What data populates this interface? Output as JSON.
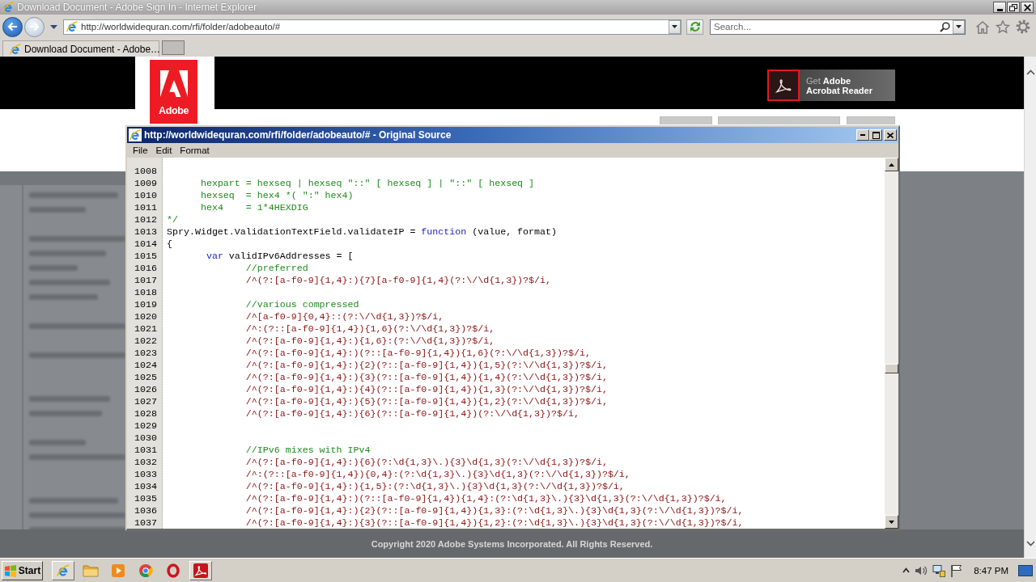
{
  "browser": {
    "title": "Download Document - Adobe Sign In - Internet Explorer",
    "address": "http://worldwidequran.com/rfi/folder/adobeauto/#",
    "search": {
      "placeholder": "Search..."
    },
    "tabs": [
      {
        "label": "Download Document - Adobe…",
        "selected": true
      }
    ]
  },
  "page": {
    "logo": "Adobe",
    "reader_button": {
      "lead": "Get",
      "title": "Adobe",
      "subtitle": "Acrobat Reader"
    },
    "footer": "Copyright 2020 Adobe Systems Incorporated. All Rights Reserved."
  },
  "source_window": {
    "title": "http://worldwidequran.com/rfi/folder/adobeauto/# - Original Source",
    "menu": [
      "File",
      "Edit",
      "Format"
    ],
    "lines": [
      {
        "number": "1008"
      },
      {
        "number": "1009",
        "segments": [
          {
            "kind": "comment",
            "text": "      hexpart = hexseq | hexseq \"::\" [ hexseq ] | \"::\" [ hexseq ]"
          }
        ]
      },
      {
        "number": "1010",
        "segments": [
          {
            "kind": "comment",
            "text": "      hexseq  = hex4 *( \":\" hex4)"
          }
        ]
      },
      {
        "number": "1011",
        "segments": [
          {
            "kind": "comment",
            "text": "      hex4    = 1*4HEXDIG"
          }
        ]
      },
      {
        "number": "1012",
        "segments": [
          {
            "kind": "comment",
            "text": "*/"
          }
        ]
      },
      {
        "number": "1013",
        "segments": [
          {
            "kind": "plain",
            "text": "Spry.Widget.ValidationTextField.validateIP = "
          },
          {
            "kind": "keyword",
            "text": "function"
          },
          {
            "kind": "plain",
            "text": " (value, format)"
          }
        ]
      },
      {
        "number": "1014",
        "segments": [
          {
            "kind": "plain",
            "text": "{"
          }
        ]
      },
      {
        "number": "1015",
        "segments": [
          {
            "kind": "keyword",
            "text": "       var"
          },
          {
            "kind": "plain",
            "text": " validIPv6Addresses = ["
          }
        ]
      },
      {
        "number": "1016",
        "segments": [
          {
            "kind": "comment",
            "text": "              //preferred"
          }
        ]
      },
      {
        "number": "1017",
        "segments": [
          {
            "kind": "regex",
            "text": "              /^(?:[a-f0-9]{1,4}:){7}[a-f0-9]{1,4}(?:\\/\\d{1,3})?$/i,"
          }
        ]
      },
      {
        "number": "1018"
      },
      {
        "number": "1019",
        "segments": [
          {
            "kind": "comment",
            "text": "              //various compressed"
          }
        ]
      },
      {
        "number": "1020",
        "segments": [
          {
            "kind": "regex",
            "text": "              /^[a-f0-9]{0,4}::(?:\\/\\d{1,3})?$/i,"
          }
        ]
      },
      {
        "number": "1021",
        "segments": [
          {
            "kind": "regex",
            "text": "              /^:(?::[a-f0-9]{1,4}){1,6}(?:\\/\\d{1,3})?$/i,"
          }
        ]
      },
      {
        "number": "1022",
        "segments": [
          {
            "kind": "regex",
            "text": "              /^(?:[a-f0-9]{1,4}:){1,6}:(?:\\/\\d{1,3})?$/i,"
          }
        ]
      },
      {
        "number": "1023",
        "segments": [
          {
            "kind": "regex",
            "text": "              /^(?:[a-f0-9]{1,4}:)(?::[a-f0-9]{1,4}){1,6}(?:\\/\\d{1,3})?$/i,"
          }
        ]
      },
      {
        "number": "1024",
        "segments": [
          {
            "kind": "regex",
            "text": "              /^(?:[a-f0-9]{1,4}:){2}(?::[a-f0-9]{1,4}){1,5}(?:\\/\\d{1,3})?$/i,"
          }
        ]
      },
      {
        "number": "1025",
        "segments": [
          {
            "kind": "regex",
            "text": "              /^(?:[a-f0-9]{1,4}:){3}(?::[a-f0-9]{1,4}){1,4}(?:\\/\\d{1,3})?$/i,"
          }
        ]
      },
      {
        "number": "1026",
        "segments": [
          {
            "kind": "regex",
            "text": "              /^(?:[a-f0-9]{1,4}:){4}(?::[a-f0-9]{1,4}){1,3}(?:\\/\\d{1,3})?$/i,"
          }
        ]
      },
      {
        "number": "1027",
        "segments": [
          {
            "kind": "regex",
            "text": "              /^(?:[a-f0-9]{1,4}:){5}(?::[a-f0-9]{1,4}){1,2}(?:\\/\\d{1,3})?$/i,"
          }
        ]
      },
      {
        "number": "1028",
        "segments": [
          {
            "kind": "regex",
            "text": "              /^(?:[a-f0-9]{1,4}:){6}(?::[a-f0-9]{1,4})(?:\\/\\d{1,3})?$/i,"
          }
        ]
      },
      {
        "number": "1029"
      },
      {
        "number": "1030"
      },
      {
        "number": "1031",
        "segments": [
          {
            "kind": "comment",
            "text": "              //IPv6 mixes with IPv4"
          }
        ]
      },
      {
        "number": "1032",
        "segments": [
          {
            "kind": "regex",
            "text": "              /^(?:[a-f0-9]{1,4}:){6}(?:\\d{1,3}\\.){3}\\d{1,3}(?:\\/\\d{1,3})?$/i,"
          }
        ]
      },
      {
        "number": "1033",
        "segments": [
          {
            "kind": "regex",
            "text": "              /^:(?::[a-f0-9]{1,4}){0,4}:(?:\\d{1,3}\\.){3}\\d{1,3}(?:\\/\\d{1,3})?$/i,"
          }
        ]
      },
      {
        "number": "1034",
        "segments": [
          {
            "kind": "regex",
            "text": "              /^(?:[a-f0-9]{1,4}:){1,5}:(?:\\d{1,3}\\.){3}\\d{1,3}(?:\\/\\d{1,3})?$/i,"
          }
        ]
      },
      {
        "number": "1035",
        "segments": [
          {
            "kind": "regex",
            "text": "              /^(?:[a-f0-9]{1,4}:)(?::[a-f0-9]{1,4}){1,4}:(?:\\d{1,3}\\.){3}\\d{1,3}(?:\\/\\d{1,3})?$/i,"
          }
        ]
      },
      {
        "number": "1036",
        "segments": [
          {
            "kind": "regex",
            "text": "              /^(?:[a-f0-9]{1,4}:){2}(?::[a-f0-9]{1,4}){1,3}:(?:\\d{1,3}\\.){3}\\d{1,3}(?:\\/\\d{1,3})?$/i,"
          }
        ]
      },
      {
        "number": "1037",
        "segments": [
          {
            "kind": "regex",
            "text": "              /^(?:[a-f0-9]{1,4}:){3}(?::[a-f0-9]{1,4}){1,2}:(?:\\d{1,3}\\.){3}\\d{1,3}(?:\\/\\d{1,3})?$/i,"
          }
        ]
      }
    ]
  },
  "taskbar": {
    "start": "Start",
    "items": [
      {
        "kind": "browser",
        "open": true
      },
      {
        "kind": "folder",
        "open": false
      },
      {
        "kind": "player",
        "open": false
      },
      {
        "kind": "wheel",
        "open": false
      },
      {
        "kind": "ring",
        "open": false
      },
      {
        "kind": "reader",
        "open": true
      }
    ],
    "clock": "8:47 PM"
  }
}
